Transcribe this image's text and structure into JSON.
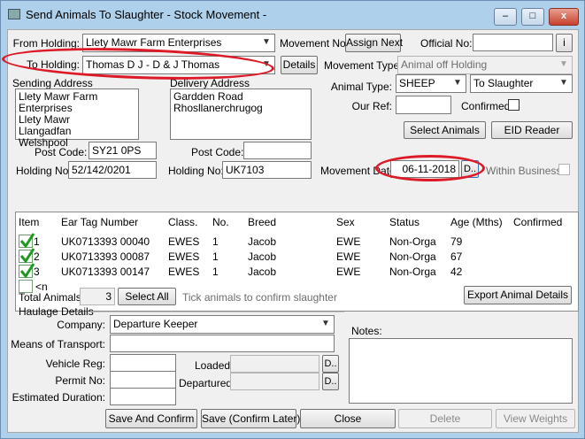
{
  "window": {
    "title": "Send Animals To Slaughter - Stock Movement -",
    "minimize": "–",
    "maximize": "□",
    "close": "x"
  },
  "header": {
    "from_holding_label": "From Holding:",
    "from_holding_value": "Llety Mawr Farm Enterprises",
    "to_holding_label": "To Holding:",
    "to_holding_value": "Thomas D J - D & J Thomas",
    "details_button": "Details",
    "movement_no_label": "Movement No:",
    "assign_next_button": "Assign Next",
    "official_no_label": "Official No:",
    "official_no_value": "",
    "info_button": "i",
    "movement_type_label": "Movement Type:",
    "movement_type_value": "Animal off Holding",
    "animal_type_label": "Animal Type:",
    "animal_type_value": "SHEEP",
    "destination_value": "To Slaughter",
    "our_ref_label": "Our Ref:",
    "our_ref_value": "",
    "confirmed_label": "Confirmed:",
    "select_animals_button": "Select Animals",
    "eid_reader_button": "EID Reader"
  },
  "sending": {
    "label": "Sending Address",
    "lines": [
      "Llety Mawr Farm Enterprises",
      "Llety Mawr",
      "Llangadfan",
      "Welshpool"
    ],
    "post_code_label": "Post Code:",
    "post_code_value": "SY21 0PS",
    "holding_no_label": "Holding No:",
    "holding_no_value": "52/142/0201"
  },
  "delivery": {
    "label": "Delivery Address",
    "lines": [
      "Gardden Road",
      "Rhosllanerchrugog"
    ],
    "post_code_label": "Post Code:",
    "post_code_value": "",
    "holding_no_label": "Holding No:",
    "holding_no_value": "UK7103"
  },
  "movement_date": {
    "label": "Movement Date:",
    "value": "06-11-2018",
    "picker_button": "D..",
    "within_business_label": "Within Business"
  },
  "grid": {
    "headers": [
      "Item",
      "Ear Tag Number",
      "Class.",
      "No.",
      "Breed",
      "Sex",
      "Status",
      "Age (Mths)",
      "Confirmed"
    ],
    "rows": [
      {
        "item": "1",
        "tag": "UK0713393 00040",
        "class": "EWES",
        "no": "1",
        "breed": "Jacob",
        "sex": "EWE",
        "status": "Non-Orga",
        "age": "79",
        "confirmed": ""
      },
      {
        "item": "2",
        "tag": "UK0713393 00087",
        "class": "EWES",
        "no": "1",
        "breed": "Jacob",
        "sex": "EWE",
        "status": "Non-Orga",
        "age": "67",
        "confirmed": ""
      },
      {
        "item": "3",
        "tag": "UK0713393 00147",
        "class": "EWES",
        "no": "1",
        "breed": "Jacob",
        "sex": "EWE",
        "status": "Non-Orga",
        "age": "42",
        "confirmed": ""
      }
    ],
    "new_row": "<n"
  },
  "totals": {
    "total_animals_label": "Total Animals:",
    "total_animals_value": "3",
    "select_all_button": "Select All",
    "hint": "Tick animals to confirm slaughter",
    "export_button": "Export Animal Details"
  },
  "haulage": {
    "group_label": "Haulage Details",
    "company_label": "Company:",
    "company_value": "Departure Keeper",
    "means_label": "Means of Transport:",
    "means_value": "",
    "vehicle_reg_label": "Vehicle Reg:",
    "vehicle_reg_value": "",
    "permit_no_label": "Permit No:",
    "permit_no_value": "",
    "estimated_duration_label": "Estimated Duration:",
    "estimated_duration_value": "",
    "loaded_label": "Loaded:",
    "loaded_value": "",
    "loaded_button": "D..",
    "departured_label": "Departured:",
    "departured_value": "",
    "departured_button": "D.."
  },
  "notes": {
    "label": "Notes:",
    "value": ""
  },
  "footer": {
    "save_confirm": "Save And Confirm",
    "save_confirm_later": "Save (Confirm Later)",
    "close": "Close",
    "delete": "Delete",
    "view_weights": "View Weights"
  },
  "colors": {
    "highlight": "#dd1b28",
    "tick": "#1d9a1d",
    "window_frame": "#aed0ea"
  }
}
